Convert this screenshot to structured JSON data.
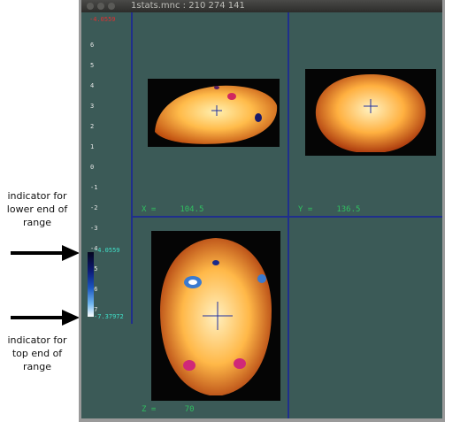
{
  "window": {
    "title": "1stats.mnc : 210 274 141"
  },
  "annotations": {
    "lower": "indicator for lower end of range",
    "upper": "indicator for top end of range"
  },
  "scale": {
    "top_value": "-4.0559",
    "ticks": [
      "6",
      "5",
      "4",
      "3",
      "2",
      "1",
      "0",
      "-1",
      "-2",
      "-3",
      "-4",
      "-5",
      "-6",
      "-7"
    ],
    "colorbar_low": "-4.0559",
    "colorbar_high": "-7.37972"
  },
  "views": {
    "sagittal_label": "X =     104.5",
    "coronal_label": "Y =     136.5",
    "axial_label": "Z =      70"
  },
  "colors": {
    "background": "#3b5a57",
    "divider": "#1f2f8c",
    "coord_text": "#30c060",
    "brain_warm": "#ffbb4a",
    "cursor": "#1f2fa0"
  },
  "icons": [
    "right-arrow-icon",
    "right-arrow-icon"
  ]
}
